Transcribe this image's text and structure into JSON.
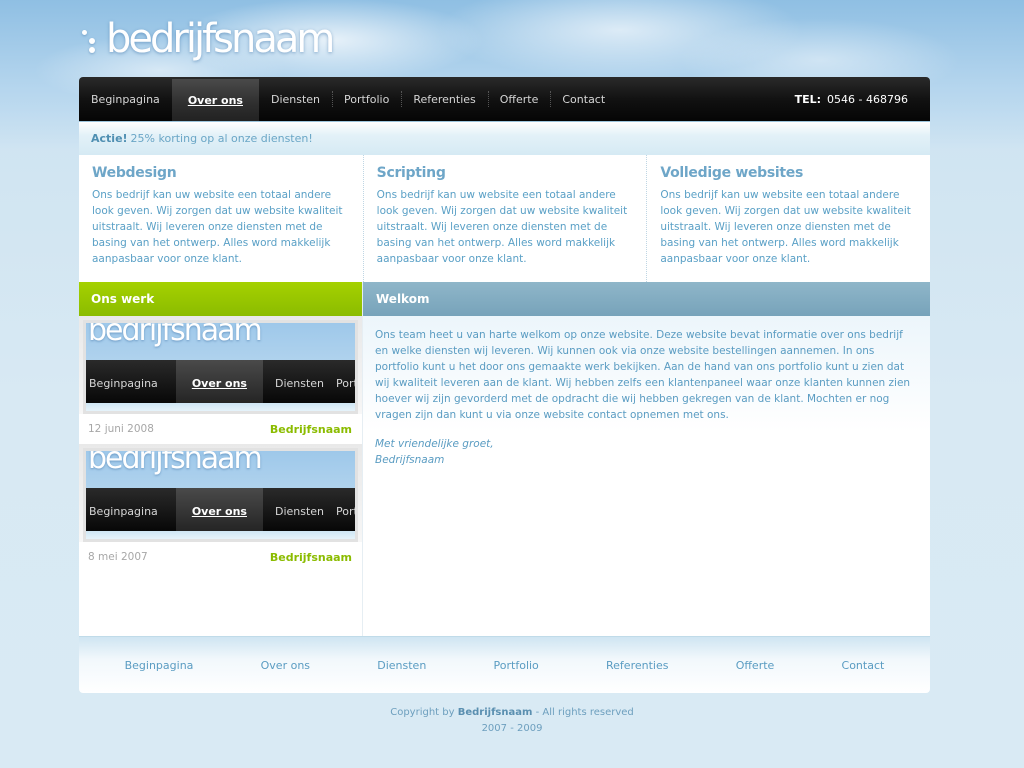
{
  "logo": {
    "text": "bedrijfsnaam"
  },
  "nav": {
    "items": [
      "Beginpagina",
      "Over ons",
      "Diensten",
      "Portfolio",
      "Referenties",
      "Offerte",
      "Contact"
    ],
    "active_index": 1
  },
  "tel": {
    "label": "TEL:",
    "number": "0546 - 468796"
  },
  "promo": {
    "label": "Actie!",
    "text": "25% korting op al onze diensten!"
  },
  "services": [
    {
      "title": "Webdesign",
      "text": "Ons bedrijf kan uw website een totaal andere look geven. Wij zorgen dat uw website kwaliteit uitstraalt. Wij leveren onze diensten met de basing van het ontwerp. Alles word makkelijk aanpasbaar voor onze klant."
    },
    {
      "title": "Scripting",
      "text": "Ons bedrijf kan uw website een totaal andere look geven. Wij zorgen dat uw website kwaliteit uitstraalt. Wij leveren onze diensten met de basing van het ontwerp. Alles word makkelijk aanpasbaar voor onze klant."
    },
    {
      "title": "Volledige websites",
      "text": "Ons bedrijf kan uw website een totaal andere look geven. Wij zorgen dat uw website kwaliteit uitstraalt. Wij leveren onze diensten met de basing van het ontwerp. Alles word makkelijk aanpasbaar voor onze klant."
    }
  ],
  "ons_werk": {
    "title": "Ons werk",
    "items": [
      {
        "thumb_logo": "bedrijfsnaam",
        "thumb_nav": [
          "Beginpagina",
          "Over ons",
          "Diensten",
          "Portfo"
        ],
        "date": "12 juni 2008",
        "by": "Bedrijfsnaam"
      },
      {
        "thumb_logo": "bedrijfsnaam",
        "thumb_nav": [
          "Beginpagina",
          "Over ons",
          "Diensten",
          "Portfo"
        ],
        "date": "8 mei 2007",
        "by": "Bedrijfsnaam"
      }
    ]
  },
  "welkom": {
    "title": "Welkom",
    "text": "Ons team heet u van harte welkom op onze website. Deze website bevat informatie over ons bedrijf en welke diensten wij leveren. Wij kunnen ook via onze website bestellingen aannemen. In ons portfolio kunt u het door ons gemaakte werk bekijken. Aan de hand van ons portfolio kunt u zien dat wij kwaliteit leveren aan de klant. Wij hebben zelfs een klantenpaneel  waar onze klanten kunnen zien hoever wij zijn gevorderd met de opdracht die wij hebben gekregen van de klant. Mochten er nog vragen zijn dan kunt u via onze website contact opnemen met ons.",
    "closing_line1": "Met vriendelijke groet,",
    "closing_line2": "Bedrijfsnaam"
  },
  "footer_nav": [
    "Beginpagina",
    "Over ons",
    "Diensten",
    "Portfolio",
    "Referenties",
    "Offerte",
    "Contact"
  ],
  "copyright": {
    "prefix": "Copyright by",
    "brand": "Bedrijfsnaam",
    "suffix": "- All rights reserved",
    "years": "2007 - 2009"
  },
  "colors": {
    "accent_green": "#8bbc00",
    "accent_blue": "#77a3ba",
    "text_blue": "#5a9cc2",
    "nav_dark": "#121212"
  }
}
